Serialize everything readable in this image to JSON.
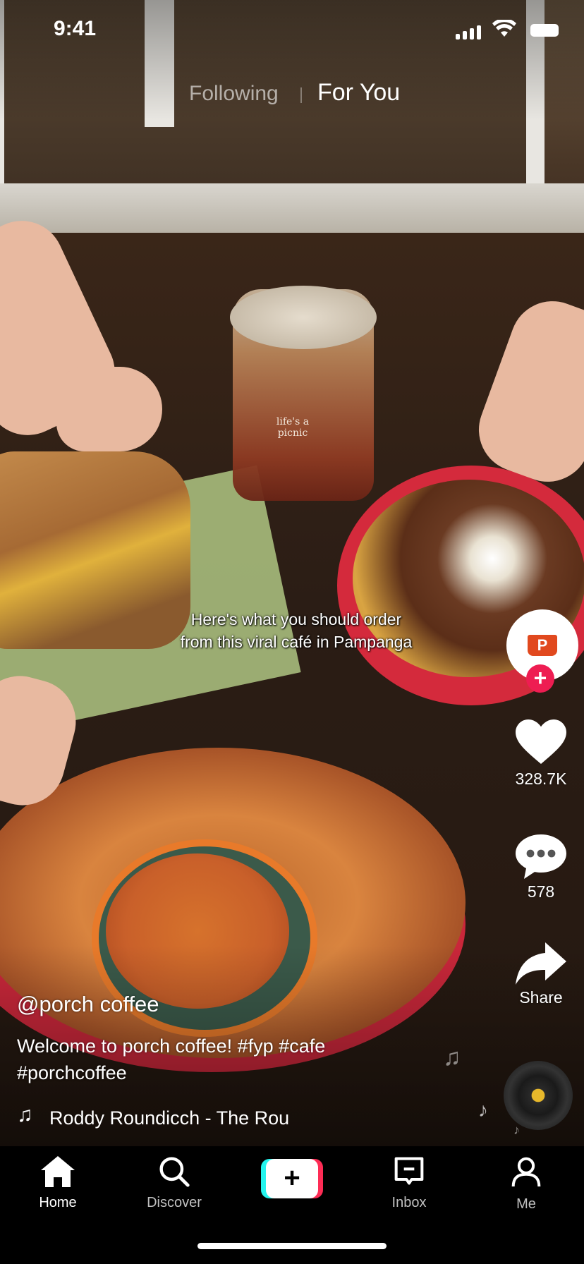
{
  "status_bar": {
    "time": "9:41"
  },
  "feed_tabs": {
    "following": "Following",
    "for_you": "For You"
  },
  "video": {
    "overlay_text_line1": "Here's what you should order",
    "overlay_text_line2": "from this viral café in Pampanga",
    "cup_logo": "life's a picnic"
  },
  "creator": {
    "avatar_logo": "P"
  },
  "actions": {
    "likes": "328.7K",
    "comments": "578",
    "share": "Share"
  },
  "post": {
    "username": "@porch coffee",
    "caption": "Welcome to porch coffee! #fyp #cafe #porchcoffee",
    "sound": "Roddy Roundicch - The Rou"
  },
  "tab_bar": {
    "home": "Home",
    "discover": "Discover",
    "create": "+",
    "inbox": "Inbox",
    "me": "Me"
  },
  "icons": {
    "like": "heart-icon",
    "comment": "comment-icon",
    "share": "share-icon",
    "music": "music-note-icon"
  },
  "colors": {
    "accent_pink": "#fe2c55",
    "accent_cyan": "#25f4ee",
    "follow_red": "#ee1d52",
    "disc_gold": "#e7b82b"
  }
}
